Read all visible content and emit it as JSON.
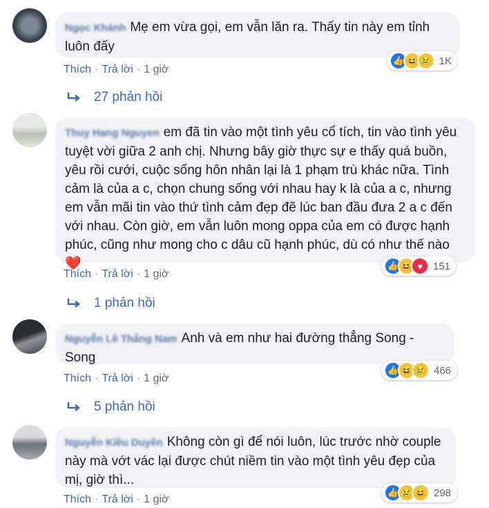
{
  "comments": [
    {
      "author": "Ngọc Khánh",
      "text": "Mẹ em vừa gọi, em vẫn lăn ra. Thấy tin này em tỉnh luôn đấy",
      "actions": {
        "like": "Thích",
        "reply": "Trả lời",
        "time": "1 giờ"
      },
      "reactions": {
        "types": [
          "like",
          "haha",
          "sad"
        ],
        "count": "1K"
      },
      "replies": "27 phản hồi"
    },
    {
      "author": "Thuy Hang Nguyen",
      "text": "em đã tin vào một tình yêu cổ tích, tin vào tình yêu tuyệt vời giữa 2 anh chị. Nhưng bây giờ thực sự e thấy quá buồn, yêu rồi cưới, cuộc sống hôn nhân lại là 1 phạm trù khác nữa. Tình cảm là của a c, chọn chung sống với nhau hay k là của a c, nhưng em vẫn mãi tin vào thứ tình cảm đẹp đẽ lúc ban đầu đưa 2 a c đến với nhau. Còn giờ, em vẫn luôn mong oppa của em có được hạnh phúc, cũng như mong cho c dâu cũ hạnh phúc, dù có như thế nào ❤️",
      "actions": {
        "like": "Thích",
        "reply": "Trả lời",
        "time": "1 giờ"
      },
      "reactions": {
        "types": [
          "like",
          "haha",
          "love"
        ],
        "count": "151"
      },
      "replies": "1 phản hồi"
    },
    {
      "author": "Nguyễn Lê Thắng Nam",
      "text": "Anh và em như hai đường thẳng Song - Song",
      "actions": {
        "like": "Thích",
        "reply": "Trả lời",
        "time": "1 giờ"
      },
      "reactions": {
        "types": [
          "like",
          "haha",
          "sad"
        ],
        "count": "466"
      },
      "replies": "5 phản hồi"
    },
    {
      "author": "Nguyễn Kiều Duyên",
      "text": "Không còn gì để nói luôn, lúc trước nhờ couple này mà vớt vác lại được chút niềm tin vào một tình yêu đẹp của mị, giờ thì...",
      "actions": {
        "like": "Thích",
        "reply": "Trả lời",
        "time": "1 giờ"
      },
      "reactions": {
        "types": [
          "like",
          "sad",
          "haha"
        ],
        "count": "298"
      }
    }
  ]
}
